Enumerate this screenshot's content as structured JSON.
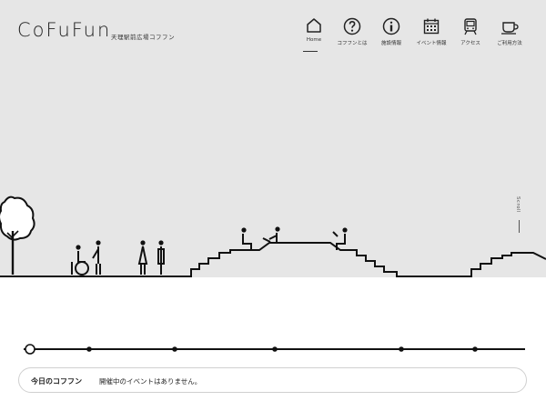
{
  "header": {
    "logo": "CoFuFun",
    "tagline": "天理駅前広場コフフン"
  },
  "nav": [
    {
      "label": "Home",
      "icon": "home-icon",
      "active": true
    },
    {
      "label": "コフフンとは",
      "icon": "question-icon",
      "active": false
    },
    {
      "label": "施設情報",
      "icon": "info-icon",
      "active": false
    },
    {
      "label": "イベント情報",
      "icon": "calendar-icon",
      "active": false
    },
    {
      "label": "アクセス",
      "icon": "train-icon",
      "active": false
    },
    {
      "label": "ご利用方法",
      "icon": "cup-icon",
      "active": false
    }
  ],
  "scroll": {
    "label": "Scroll"
  },
  "status": {
    "label": "今日のコフフン",
    "message": "開催中のイベントはありません。"
  }
}
